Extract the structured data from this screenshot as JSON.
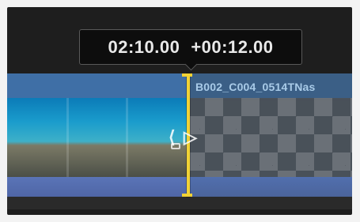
{
  "tooltip": {
    "timecode": "02:10.00",
    "delta": "+00:12.00"
  },
  "clips": [
    {
      "title": ""
    },
    {
      "title": "B002_C004_0514TNas"
    }
  ],
  "icons": {
    "trim_left": "left-bracket-icon",
    "trim_right": "right-arrow-icon",
    "clip_badge": "clip-badge-icon"
  },
  "colors": {
    "edit_marker": "#f1d235",
    "clip_blue": "#2f6db3",
    "audio_blue": "#5a74b7"
  }
}
